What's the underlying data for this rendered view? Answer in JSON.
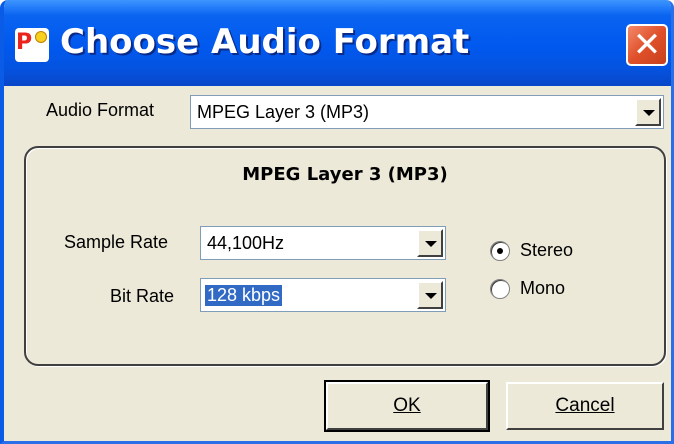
{
  "window": {
    "title": "Choose Audio Format",
    "close_symbol": "✕"
  },
  "audio_format": {
    "label": "Audio Format",
    "value": "MPEG Layer 3 (MP3)"
  },
  "group": {
    "title": "MPEG Layer 3 (MP3)",
    "sample_rate": {
      "label": "Sample Rate",
      "value": "44,100Hz"
    },
    "bit_rate": {
      "label": "Bit Rate",
      "value": "128 kbps"
    },
    "channels": [
      {
        "label": "Stereo",
        "checked": true
      },
      {
        "label": "Mono",
        "checked": false
      }
    ]
  },
  "buttons": {
    "ok": "OK",
    "cancel": "Cancel"
  },
  "icons": {
    "app": "app-logo-icon",
    "close": "close-icon",
    "dropdown": "chevron-down-icon"
  }
}
